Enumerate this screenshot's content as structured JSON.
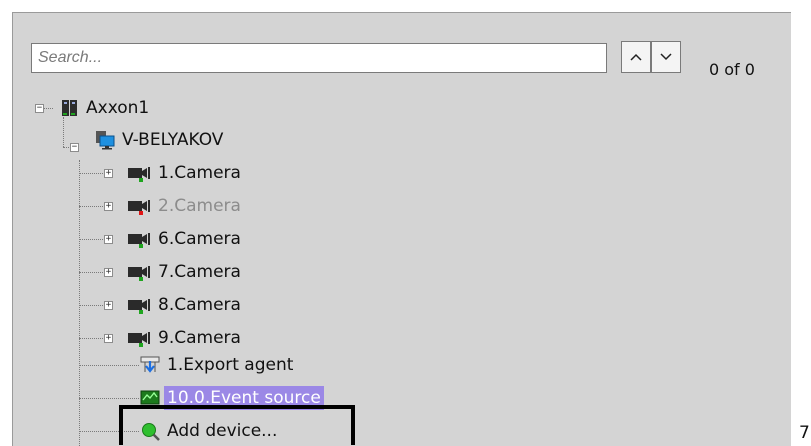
{
  "search": {
    "placeholder": "Search...",
    "counter": "0 of 0"
  },
  "tree": {
    "root": {
      "label": "Axxon1",
      "icon": "server-icon"
    },
    "server": {
      "label": "V-BELYAKOV",
      "icon": "computer-icon"
    },
    "devices": [
      {
        "label": "1.Camera",
        "status": "ok",
        "status_color": "#1fa51f"
      },
      {
        "label": "2.Camera",
        "status": "error",
        "status_color": "#e01515"
      },
      {
        "label": "6.Camera",
        "status": "ok",
        "status_color": "#1fa51f"
      },
      {
        "label": "7.Camera",
        "status": "ok",
        "status_color": "#1fa51f"
      },
      {
        "label": "8.Camera",
        "status": "ok",
        "status_color": "#1fa51f"
      },
      {
        "label": "9.Camera",
        "status": "ok",
        "status_color": "#1fa51f"
      }
    ],
    "export_agent": {
      "label": "1.Export agent",
      "icon": "export-agent-icon"
    },
    "event_source": {
      "label": "10.0.Event source",
      "icon": "event-source-icon",
      "selected": true
    },
    "add_device": {
      "label": "Add device...",
      "icon": "add-device-icon"
    }
  },
  "edge_text": "7",
  "colors": {
    "panel": "#d4d4d4",
    "selection": "#9b88e6",
    "status_ok": "#1fa51f",
    "status_error": "#e01515"
  }
}
